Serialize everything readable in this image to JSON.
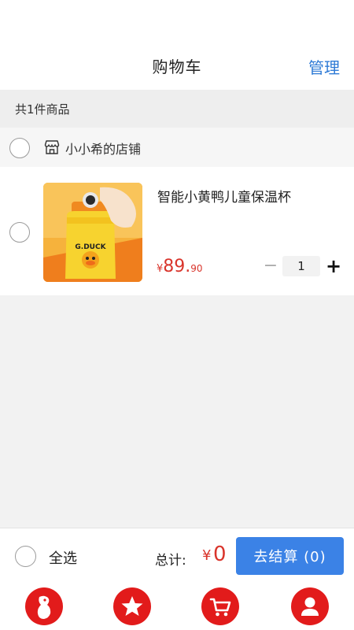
{
  "header": {
    "title": "购物车",
    "manage_label": "管理"
  },
  "cart": {
    "count_text": "共1件商品"
  },
  "shop": {
    "name": "小小希的店铺",
    "icon": "store-icon"
  },
  "item": {
    "title": "智能小黄鸭儿童保温杯",
    "price_symbol": "¥",
    "price_int": "89.",
    "price_dec": "90",
    "quantity": "1",
    "minus_label": "−",
    "plus_label": "+",
    "image_label": "G.DUCK"
  },
  "footer": {
    "select_all_label": "全选",
    "total_label": "总计:",
    "total_symbol": "¥",
    "total_value": "0",
    "checkout_label": "去结算 (0)"
  },
  "tabs": [
    {
      "icon": "bird-icon"
    },
    {
      "icon": "star-icon"
    },
    {
      "icon": "cart-icon"
    },
    {
      "icon": "user-icon"
    }
  ],
  "colors": {
    "accent": "#3b82e6",
    "price": "#d9342b",
    "tab": "#e21b1b"
  }
}
